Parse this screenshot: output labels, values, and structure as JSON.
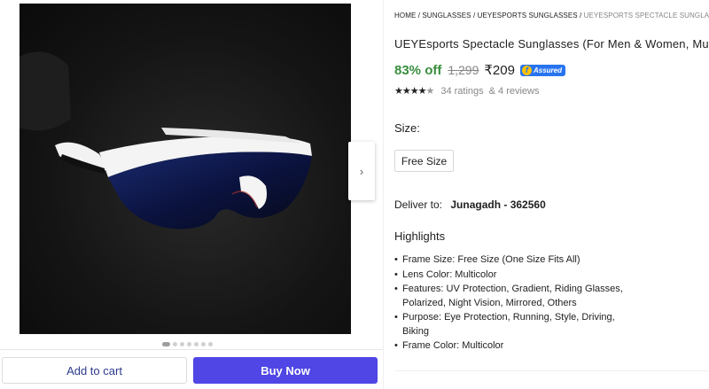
{
  "breadcrumbs": {
    "items": [
      "HOME",
      "SUNGLASSES",
      "UEYESPORTS SUNGLASSES"
    ],
    "last": "UEYESPORTS SPECTACLE SUNGLASSES (F...",
    "separator": " / "
  },
  "product": {
    "title": "UEYEsports Spectacle  Sunglasses (For Men & Women, Multic",
    "discount": "83% off",
    "mrp": "1,299",
    "price": "₹209",
    "assured_label": "Assured",
    "assured_mark": "f",
    "stars": "★★★★",
    "half_star": "★",
    "ratings": "34 ratings",
    "reviews": "& 4 reviews"
  },
  "size": {
    "label": "Size:",
    "option": "Free Size"
  },
  "delivery": {
    "label": "Deliver to:",
    "location": "Junagadh - 362560"
  },
  "highlights": {
    "title": "Highlights",
    "items": [
      "Frame Size: Free Size (One Size Fits All)",
      "Lens Color: Multicolor",
      "Features: UV Protection, Gradient, Riding Glasses, Polarized, Night Vision, Mirrored, Others",
      "Purpose: Eye Protection, Running, Style, Driving, Biking",
      "Frame Color: Multicolor"
    ]
  },
  "gallery": {
    "next_icon": "›",
    "image_count": 7,
    "active_index": 0
  },
  "actions": {
    "add_to_cart": "Add to cart",
    "buy_now": "Buy Now"
  },
  "colors": {
    "discount_green": "#388e3c",
    "buy_button": "#4f46e5",
    "assured_blue": "#2874f0",
    "cart_text": "#2d3a8c"
  }
}
